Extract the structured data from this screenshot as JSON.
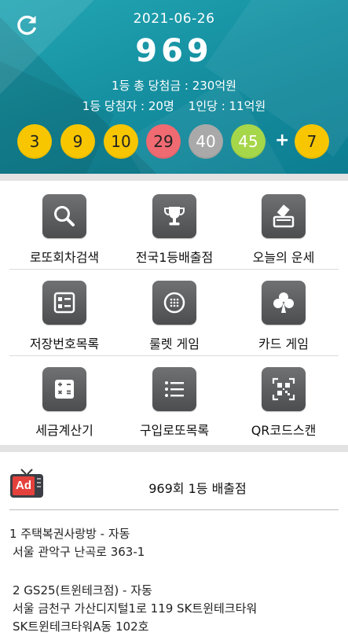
{
  "header": {
    "date": "2021-06-26",
    "round": "969",
    "first_prize_total": "1등 총 당첨금 : 230억원",
    "winners": "1등 당첨자 : 20명",
    "per_person": "1인당 : 11억원",
    "plus": "+",
    "balls": [
      {
        "number": "3",
        "color": "#f7c600"
      },
      {
        "number": "9",
        "color": "#f7c600"
      },
      {
        "number": "10",
        "color": "#f7c600"
      },
      {
        "number": "29",
        "color": "#f06a72"
      },
      {
        "number": "40",
        "color": "#a9a9a9"
      },
      {
        "number": "45",
        "color": "#a6d64a"
      }
    ],
    "bonus": {
      "number": "7",
      "color": "#f7c600"
    }
  },
  "menu": [
    {
      "label": "로또회차검색",
      "icon": "search-icon"
    },
    {
      "label": "전국1등배출점",
      "icon": "trophy-icon"
    },
    {
      "label": "오늘의 운세",
      "icon": "ballot-box-icon"
    },
    {
      "label": "저장번호목록",
      "icon": "saved-list-icon"
    },
    {
      "label": "룰렛 게임",
      "icon": "roulette-icon"
    },
    {
      "label": "카드 게임",
      "icon": "club-card-icon"
    },
    {
      "label": "세금계산기",
      "icon": "calculator-icon"
    },
    {
      "label": "구입로또목록",
      "icon": "list-icon"
    },
    {
      "label": "QR코드스캔",
      "icon": "qr-code-icon"
    }
  ],
  "stores": {
    "ad_label": "Ad",
    "title": "969회 1등 배출점",
    "entries": [
      {
        "name": "1 주택복권사랑방 - 자동",
        "address": "서울 관악구 난곡로 363-1"
      },
      {
        "name": "2 GS25(트윈테크점) - 자동",
        "address": "서울 금천구 가산디지털1로 119 SK트윈테크타워"
      },
      {
        "name": "SK트윈테크타워A동 102호",
        "address": ""
      }
    ]
  },
  "colors": {
    "header_teal": "#1a98a8",
    "tile_gray": "#5a5c5e",
    "separator": "#e3e3e3",
    "ad_red": "#e5413c"
  }
}
